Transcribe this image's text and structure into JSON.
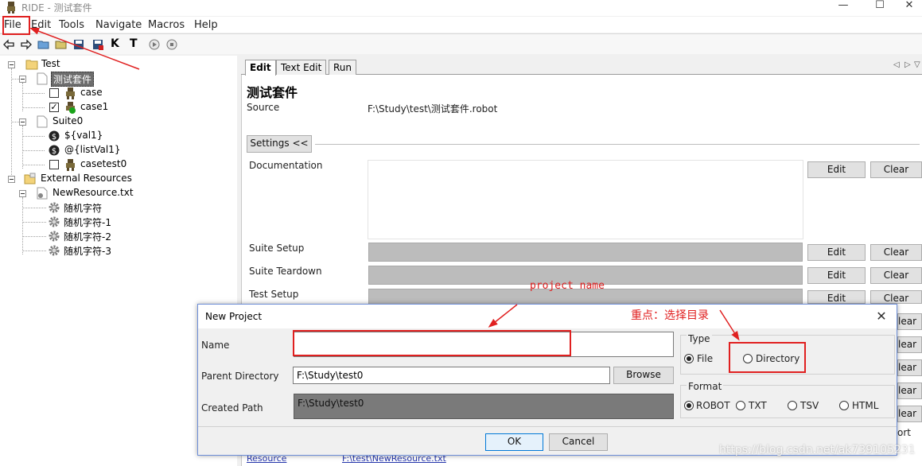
{
  "window": {
    "title": "RIDE - 测试套件"
  },
  "menu": [
    "File",
    "Edit",
    "Tools",
    "Navigate",
    "Macros",
    "Help"
  ],
  "toolbar": {
    "icons": [
      "back-arrow-icon",
      "forward-arrow-icon",
      "open-folder-icon",
      "open-dir-icon",
      "save-icon",
      "save-all-icon",
      "search-keywords-icon",
      "search-tests-icon",
      "run-icon",
      "stop-icon"
    ],
    "k_glyph": "K",
    "t_glyph": "T"
  },
  "tree": {
    "root": "Test",
    "suite_selected": "测试套件",
    "test_case": "case",
    "test_case1": "case1",
    "suite0": "Suite0",
    "var1": "${val1}",
    "var2": "@{listVal1}",
    "casetest0": "casetest0",
    "external": "External Resources",
    "resource": "NewResource.txt",
    "kw1": "随机字符",
    "kw2": "随机字符-1",
    "kw3": "随机字符-2",
    "kw4": "随机字符-3"
  },
  "editor": {
    "tabs": [
      "Edit",
      "Text Edit",
      "Run"
    ],
    "suite_title": "测试套件",
    "source_label": "Source",
    "source_value": "F:\\Study\\test\\测试套件.robot",
    "settings_button": "Settings <<",
    "documentation_label": "Documentation",
    "suite_setup_label": "Suite Setup",
    "suite_teardown_label": "Suite Teardown",
    "test_setup_label": "Test Setup",
    "edit_label": "Edit",
    "clear_label": "Clear",
    "partial_clear": "lear",
    "partial_import": "ort",
    "bottom_left_text": "Resource",
    "bottom_mid_text": "F:\\test\\NewResource.txt"
  },
  "dialog": {
    "title": "New Project",
    "name_label": "Name",
    "name_value": "",
    "parent_label": "Parent Directory",
    "parent_value": "F:\\Study\\test0",
    "browse": "Browse",
    "created_label": "Created Path",
    "created_value": "F:\\Study\\test0",
    "type_label": "Type",
    "type_file": "File",
    "type_directory": "Directory",
    "format_label": "Format",
    "formats": [
      "ROBOT",
      "TXT",
      "TSV",
      "HTML"
    ],
    "ok": "OK",
    "cancel": "Cancel"
  },
  "annotations": {
    "project_name": "project  name",
    "key_point": "重点：选择目录",
    "watermark": "https://blog.csdn.net/ak739105231"
  },
  "colors": {
    "annotation_red": "#e02020",
    "dialog_border": "#6d8ed8"
  }
}
